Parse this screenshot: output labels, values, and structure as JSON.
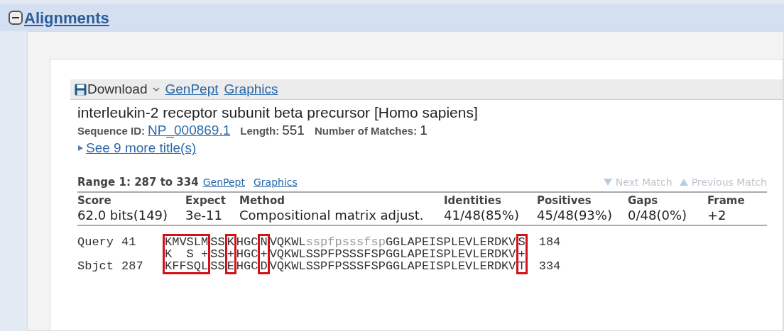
{
  "section": {
    "title": "Alignments",
    "expanded": true
  },
  "toolbar": {
    "download": "Download",
    "links": [
      "GenPept",
      "Graphics"
    ]
  },
  "hit": {
    "title": "interleukin-2 receptor subunit beta precursor [Homo sapiens]",
    "sequence_id_label": "Sequence ID:",
    "sequence_id": "NP_000869.1",
    "length_label": "Length:",
    "length": "551",
    "matches_label": "Number of Matches:",
    "matches": "1",
    "more_titles": "See 9 more title(s)"
  },
  "range": {
    "label": "Range 1: 287 to 334",
    "links": [
      "GenPept",
      "Graphics"
    ],
    "nav": [
      {
        "kind": "next",
        "label": "Next Match",
        "disabled": true
      },
      {
        "kind": "previous",
        "label": "Previous Match",
        "disabled": true
      }
    ]
  },
  "stats": {
    "columns": [
      "Score",
      "Expect",
      "Method",
      "Identities",
      "Positives",
      "Gaps",
      "Frame"
    ],
    "values": [
      "62.0 bits(149)",
      "3e-11",
      "Compositional matrix adjust.",
      "41/48(85%)",
      "45/48(93%)",
      "0/48(0%)",
      "+2"
    ]
  },
  "alignment": {
    "query_label": "Query",
    "query_start": "41",
    "query_end": "184",
    "sbjct_label": "Sbjct",
    "sbjct_start": "287",
    "sbjct_end": "334",
    "blocks": [
      {
        "query": "KMVSLM",
        "midline": "K  S +",
        "sbjct": "KFFSQL",
        "boxed": true,
        "masked": false
      },
      {
        "query": "SS",
        "midline": "SS",
        "sbjct": "SS",
        "boxed": false,
        "masked": false
      },
      {
        "query": "K",
        "midline": "+",
        "sbjct": "E",
        "boxed": true,
        "masked": false
      },
      {
        "query": "HGC",
        "midline": "HGC",
        "sbjct": "HGC",
        "boxed": false,
        "masked": false
      },
      {
        "query": "N",
        "midline": "+",
        "sbjct": "D",
        "boxed": true,
        "masked": false
      },
      {
        "query": "VQKWL",
        "midline": "VQKWL",
        "sbjct": "VQKWL",
        "boxed": false,
        "masked": false
      },
      {
        "query": "sspfpsssfsp",
        "midline": "SSPFPSSSFSP",
        "sbjct": "SSPFPSSSFSP",
        "boxed": false,
        "masked": true
      },
      {
        "query": "GGLAPEISPLEVLERDKV",
        "midline": "GGLAPEISPLEVLERDKV",
        "sbjct": "GGLAPEISPLEVLERDKV",
        "boxed": false,
        "masked": false
      },
      {
        "query": "S",
        "midline": "+",
        "sbjct": "T",
        "boxed": true,
        "masked": false
      }
    ]
  }
}
